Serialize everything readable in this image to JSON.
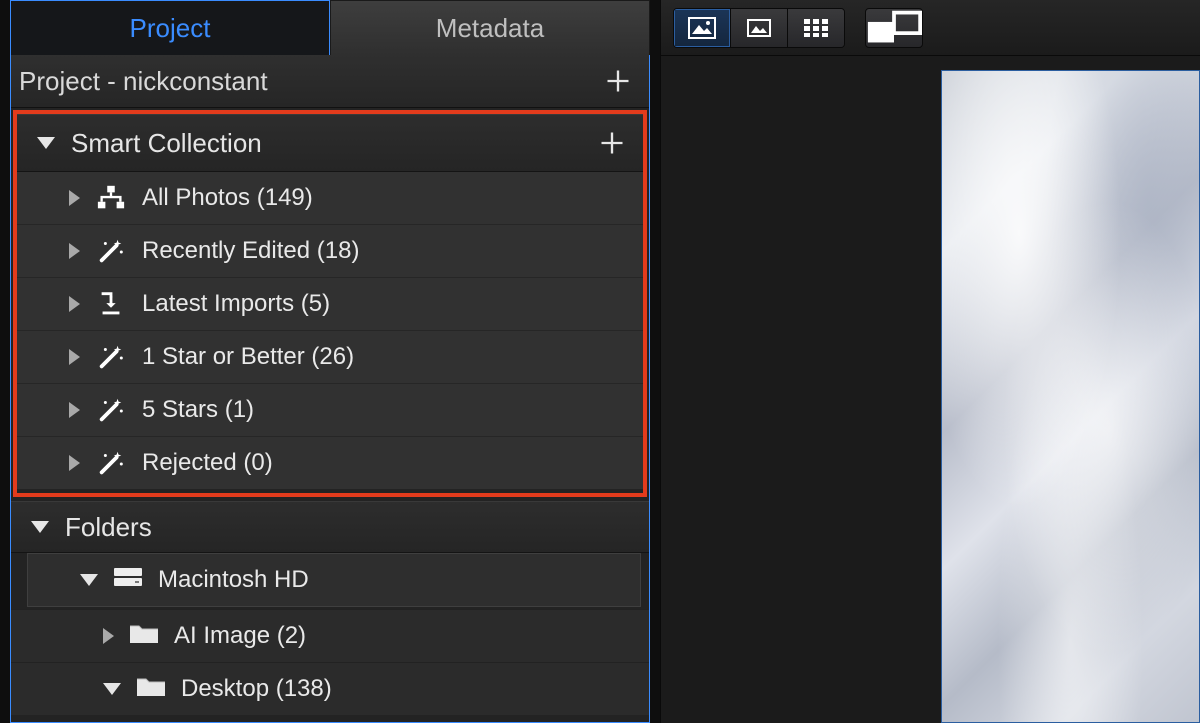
{
  "tabs": {
    "project": "Project",
    "metadata": "Metadata"
  },
  "project_header": {
    "title": "Project - nickconstant"
  },
  "smart_collection": {
    "header": "Smart Collection",
    "items": [
      {
        "label": "All Photos (149)",
        "icon": "tree-icon"
      },
      {
        "label": "Recently Edited (18)",
        "icon": "wand-icon"
      },
      {
        "label": "Latest Imports (5)",
        "icon": "import-icon"
      },
      {
        "label": "1 Star or Better (26)",
        "icon": "wand-icon"
      },
      {
        "label": "5 Stars (1)",
        "icon": "wand-icon"
      },
      {
        "label": "Rejected (0)",
        "icon": "wand-icon"
      }
    ]
  },
  "folders": {
    "header": "Folders",
    "root": {
      "label": "Macintosh HD"
    },
    "children": [
      {
        "label": "AI Image (2)"
      },
      {
        "label": "Desktop (138)"
      }
    ]
  },
  "toolbar": {
    "view_large_grid": "large-grid-view",
    "view_filmstrip": "filmstrip-view",
    "view_small_grid": "small-grid-view",
    "view_compare": "compare-view"
  },
  "colors": {
    "accent": "#3a8cff",
    "highlight": "#e33b1c"
  }
}
